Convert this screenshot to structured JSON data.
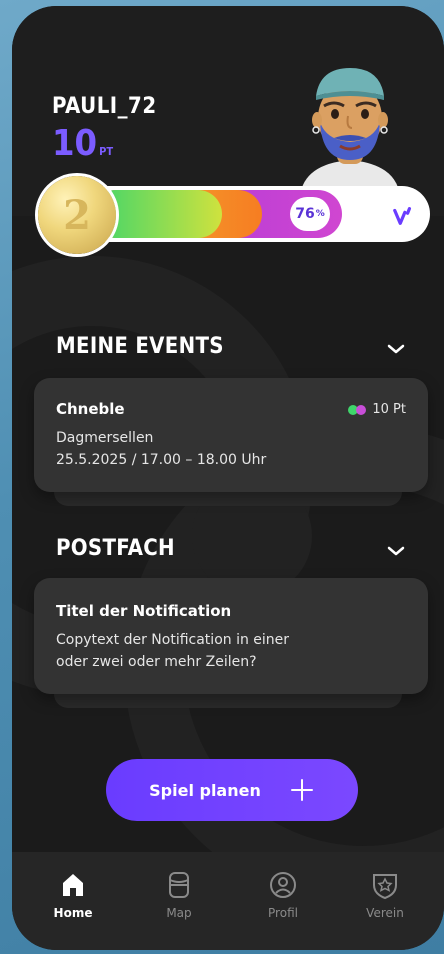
{
  "profile": {
    "username": "PAULI_72",
    "points": "10",
    "points_unit": "PT",
    "level": "2",
    "progress_percent_value": 76,
    "progress_percent_label": "76",
    "progress_percent_symbol": "%"
  },
  "events": {
    "title": "MEINE EVENTS",
    "items": [
      {
        "name": "Chneble",
        "location": "Dagmersellen",
        "datetime": "25.5.2025 / 17.00 – 18.00 Uhr",
        "points": "10 Pt"
      }
    ]
  },
  "inbox": {
    "title": "POSTFACH",
    "items": [
      {
        "title": "Titel der Notification",
        "body_line1": "Copytext der Notification in einer",
        "body_line2": "oder zwei oder mehr Zeilen?"
      }
    ]
  },
  "cta": {
    "label": "Spiel planen",
    "icon": "plus-icon"
  },
  "nav": {
    "items": [
      {
        "label": "Home",
        "icon": "home-icon",
        "active": true
      },
      {
        "label": "Map",
        "icon": "map-icon",
        "active": false
      },
      {
        "label": "Profil",
        "icon": "profile-icon",
        "active": false
      },
      {
        "label": "Verein",
        "icon": "club-badge-icon",
        "active": false
      }
    ]
  },
  "colors": {
    "accent": "#6a3cff",
    "background": "#1b1b1b",
    "card": "#333333",
    "progress_green": "#3fd56b",
    "progress_orange": "#f67d22",
    "progress_purple": "#c84ed8"
  }
}
